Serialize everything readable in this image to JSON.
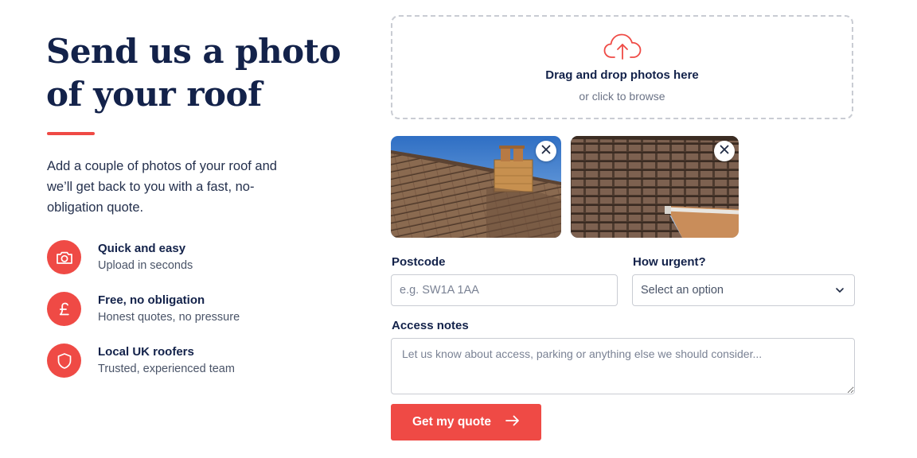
{
  "hero": {
    "title": "Send us a photo of your roof",
    "intro": "Add a couple of photos of your roof and we’ll get back to you with a fast, no-obligation quote."
  },
  "features": [
    {
      "icon": "camera-icon",
      "title": "Quick and easy",
      "subtitle": "Upload in seconds"
    },
    {
      "icon": "pound-icon",
      "title": "Free, no obligation",
      "subtitle": "Honest quotes, no pressure"
    },
    {
      "icon": "shield-icon",
      "title": "Local UK roofers",
      "subtitle": "Trusted, experienced team"
    }
  ],
  "upload": {
    "icon": "cloud-upload-icon",
    "title": "Drag and drop photos here",
    "subtitle": "or click to browse"
  },
  "photos": [
    {
      "name": "roof-photo-chimney"
    },
    {
      "name": "roof-photo-tiles"
    }
  ],
  "form": {
    "postcode": {
      "label": "Postcode",
      "placeholder": "e.g. SW1A 1AA",
      "value": ""
    },
    "urgency": {
      "label": "How urgent?",
      "selected": "Select an option"
    },
    "notes": {
      "label": "Access notes",
      "placeholder": "Let us know about access, parking or anything else we should consider..."
    },
    "submit_label": "Get my quote"
  },
  "colors": {
    "accent": "#ef4a45",
    "navy": "#13224a",
    "border": "#c9ccd3"
  }
}
